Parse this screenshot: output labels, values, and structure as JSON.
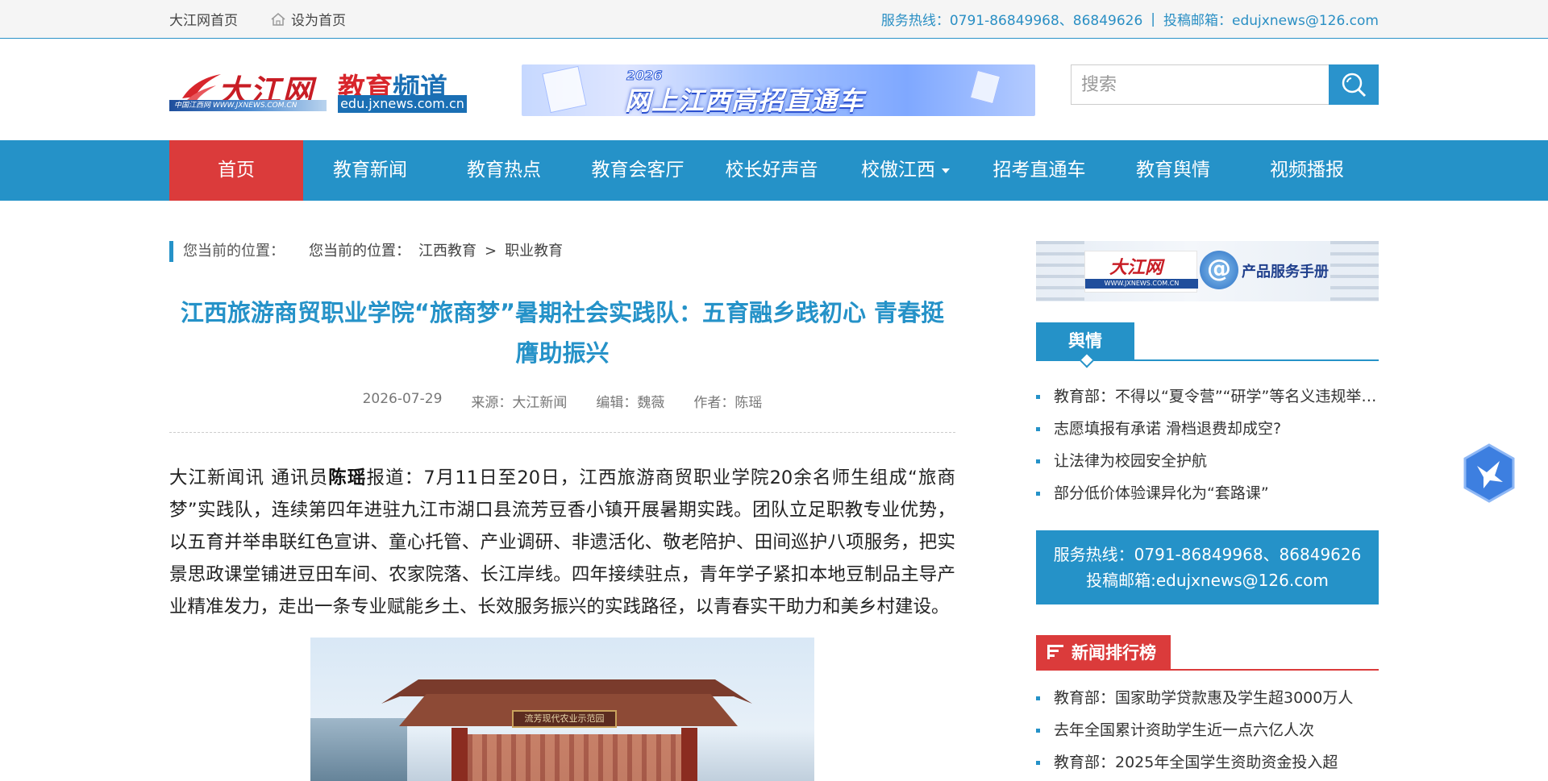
{
  "topbar": {
    "home_link": "大江网首页",
    "set_home": "设为首页",
    "hotline": "服务热线：0791-86849968、86849626",
    "separator": "|",
    "email": "投稿邮箱：edujxnews@126.com"
  },
  "logo": {
    "site_name": "大江网",
    "site_url": "中国江西网 WWW.JXNEWS.COM.CN",
    "channel_red": "教育",
    "channel_blue": "频道",
    "channel_url": "edu.jxnews.com.cn"
  },
  "banner": {
    "year": "2026",
    "title": "网上江西高招直通车"
  },
  "search": {
    "placeholder": "搜索"
  },
  "nav": {
    "items": [
      "首页",
      "教育新闻",
      "教育热点",
      "教育会客厅",
      "校长好声音",
      "校傲江西",
      "招考直通车",
      "教育舆情",
      "视频播报"
    ]
  },
  "breadcrumb": {
    "label": "您当前的位置：",
    "label2": "您当前的位置：",
    "crumb1": "江西教育",
    "sep": ">",
    "crumb2": "职业教育"
  },
  "article": {
    "title": "江西旅游商贸职业学院“旅商梦”暑期社会实践队：五育融乡践初心 青春挺膺助振兴",
    "date": "2026-07-29",
    "source": "来源：大江新闻",
    "editor": "编辑：魏薇",
    "author": "作者：陈瑶",
    "body_prefix": "大江新闻讯 通讯员",
    "body_bold": "陈瑶",
    "body_rest": "报道：7月11日至20日，江西旅游商贸职业学院20余名师生组成“旅商梦”实践队，连续第四年进驻九江市湖口县流芳豆香小镇开展暑期实践。团队立足职教专业优势，以五育并举串联红色宣讲、童心托管、产业调研、非遗活化、敬老陪护、田间巡护八项服务，把实景思政课堂铺进豆田车间、农家院落、长江岸线。四年接续驻点，青年学子紧扣本地豆制品主导产业精准发力，走出一条专业赋能乡土、长效服务振兴的实践路径，以青春实干助力和美乡村建设。",
    "photo_sign": "流芳现代农业示范园"
  },
  "sidebar": {
    "ad": {
      "site_name": "大江网",
      "url": "WWW.JXNEWS.COM.CN",
      "label": "产品服务手册"
    },
    "opinion_title": "舆情",
    "opinion_items": [
      "教育部：不得以“夏令营”“研学”等名义违规举办学科类培训",
      "志愿填报有承诺 滑档退费却成空?",
      "让法律为校园安全护航",
      "部分低价体验课异化为“套路课”"
    ],
    "service_hotline": "服务热线：0791-86849968、86849626",
    "service_email": "投稿邮箱:edujxnews@126.com",
    "rank_title": "新闻排行榜",
    "rank_items": [
      "教育部：国家助学贷款惠及学生超3000万人",
      "去年全国累计资助学生近一点六亿人次",
      "教育部：2025年全国学生资助资金投入超"
    ]
  },
  "colors": {
    "primary": "#2592c8",
    "active": "#db3b3b",
    "title": "#2592c8"
  }
}
